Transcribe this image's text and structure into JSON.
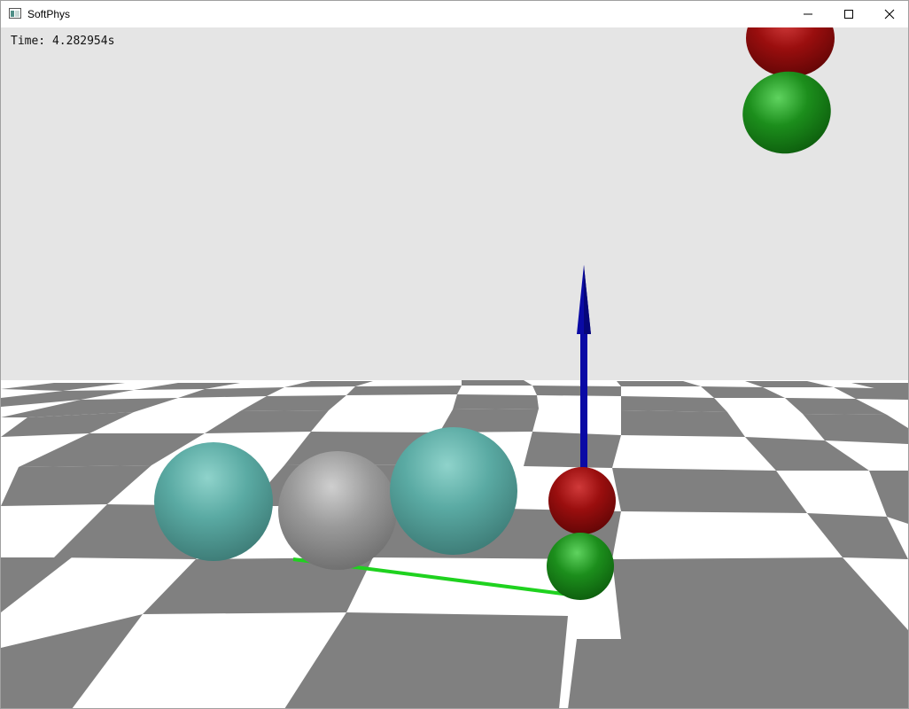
{
  "window": {
    "title": "SoftPhys",
    "icon": "app-window-icon",
    "controls": {
      "minimize": "minimize-icon",
      "maximize": "maximize-icon",
      "close": "close-icon"
    }
  },
  "viewport": {
    "time_label": "Time: 4.282954s",
    "colors": {
      "sky": "#e5e5e5",
      "floor_light": "#ffffff",
      "floor_dark": "#7f7f7f",
      "teal_sphere": "#5aaaa3",
      "gray_sphere": "#9a9a9a",
      "red_sphere": "#9a0e0e",
      "green_sphere": "#1c8e1c",
      "axis_arrow": "#0a0aa5",
      "link_line": "#1fd21f"
    }
  }
}
